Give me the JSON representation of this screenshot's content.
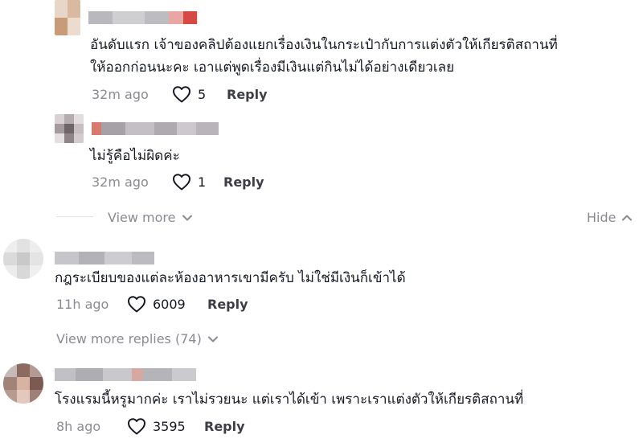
{
  "comments": [
    {
      "text_lines": [
        "อันดับแรก เจ้าของคลิปต้องแยกเรื่องเงินในกระเป๋ากับการแต่งตัวให้เกียรติสถานที่",
        "ให้ออกก่อนนะคะ เอาแต่พูดเรื่องมีเงินแต่กินไม่ได้อย่างเดียวเลย"
      ],
      "time": "32m ago",
      "likes": "5",
      "reply_label": "Reply"
    },
    {
      "text_lines": [
        "ไม่รู้คือไม่ผิดค่ะ"
      ],
      "time": "32m ago",
      "likes": "1",
      "reply_label": "Reply"
    },
    {
      "text_lines": [
        "กฎระเบียบของแต่ละห้องอาหารเขามีครับ ไม่ใช่มีเงินก็เข้าได้"
      ],
      "time": "11h ago",
      "likes": "6009",
      "reply_label": "Reply"
    },
    {
      "text_lines": [
        "โรงแรมนี้หรูมากค่ะ เราไม่รวยนะ แต่เราได้เข้า เพราะเราแต่งตัวให้เกียรติสถานที่"
      ],
      "time": "8h ago",
      "likes": "3595",
      "reply_label": "Reply"
    }
  ],
  "thread_controls": {
    "view_more": "View more",
    "hide": "Hide",
    "view_more_replies": "View more replies (74)"
  },
  "icons": {
    "like": "heart-outline-icon",
    "expand": "chevron-down-icon",
    "collapse": "chevron-up-icon"
  },
  "colors": {
    "text": "#161823",
    "muted": "#8a8b91",
    "reply": "#3d3e45"
  }
}
